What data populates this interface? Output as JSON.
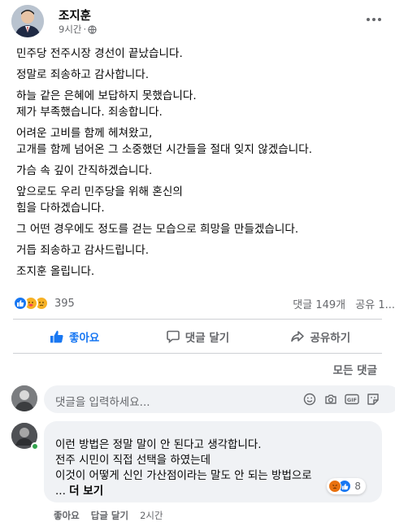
{
  "post": {
    "author": "조지훈",
    "time": "9시간",
    "separator": "·",
    "audience_icon": "globe-icon",
    "more_icon": "more-horizontal-icon",
    "paragraphs": [
      [
        "민주당 전주시장 경선이 끝났습니다."
      ],
      [
        "정말로 죄송하고 감사합니다."
      ],
      [
        "하늘 같은 은혜에 보답하지 못했습니다.",
        "제가 부족했습니다. 죄송합니다."
      ],
      [
        "어려운 고비를 함께 헤쳐왔고,",
        "고개를 함께 넘어온 그 소중했던 시간들을 절대 잊지 않겠습니다."
      ],
      [
        "가슴 속 깊이 간직하겠습니다."
      ],
      [
        "앞으로도 우리 민주당을 위해 혼신의",
        "힘을 다하겠습니다."
      ],
      [
        "그 어떤 경우에도 정도를 걷는 모습으로 희망을 만들겠습니다."
      ],
      [
        "거듭 죄송하고 감사드립니다."
      ],
      [
        "조지훈 올립니다."
      ]
    ]
  },
  "stats": {
    "reaction_icons": [
      "like-icon",
      "care-icon",
      "sad-icon"
    ],
    "reaction_count": "395",
    "comments": "댓글 149개",
    "shares": "공유 1..."
  },
  "actions": {
    "like": "좋아요",
    "comment": "댓글 달기",
    "share": "공유하기"
  },
  "all_comments": "모든 댓글",
  "composer": {
    "placeholder": "댓글을 입력하세요...",
    "icons": [
      "emoji-icon",
      "camera-icon",
      "gif-icon",
      "sticker-icon"
    ]
  },
  "comment": {
    "lines": [
      "이런 방법은 정말 말이 안 된다고 생각합니다.",
      "전주 시민이 직접 선택을 하였는데",
      "이것이 어떻게 신인 가산점이라는 말도 안 되는 방법으로"
    ],
    "ellipsis": "...",
    "see_more": "더 보기",
    "reaction_icons": [
      "angry-icon",
      "like-icon"
    ],
    "reaction_count": "8",
    "like": "좋아요",
    "reply": "답글 달기",
    "time": "2시간"
  },
  "colors": {
    "brand_blue": "#1877f2",
    "muted_text": "#65676b",
    "bubble_bg": "#f0f2f5"
  }
}
